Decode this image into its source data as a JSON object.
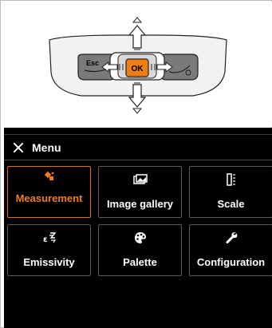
{
  "keypad": {
    "esc_label": "Esc",
    "ok_label": "OK"
  },
  "menu": {
    "title": "Menu"
  },
  "tiles": [
    {
      "label": "Measurement",
      "icon": "measurement-icon",
      "active": true
    },
    {
      "label": "Image gallery",
      "icon": "image-gallery-icon",
      "active": false
    },
    {
      "label": "Scale",
      "icon": "scale-icon",
      "active": false
    },
    {
      "label": "Emissivity",
      "icon": "emissivity-icon",
      "active": false
    },
    {
      "label": "Palette",
      "icon": "palette-icon",
      "active": false
    },
    {
      "label": "Configuration",
      "icon": "wrench-icon",
      "active": false
    }
  ],
  "colors": {
    "accent": "#f07c14",
    "screen_bg": "#000000"
  }
}
